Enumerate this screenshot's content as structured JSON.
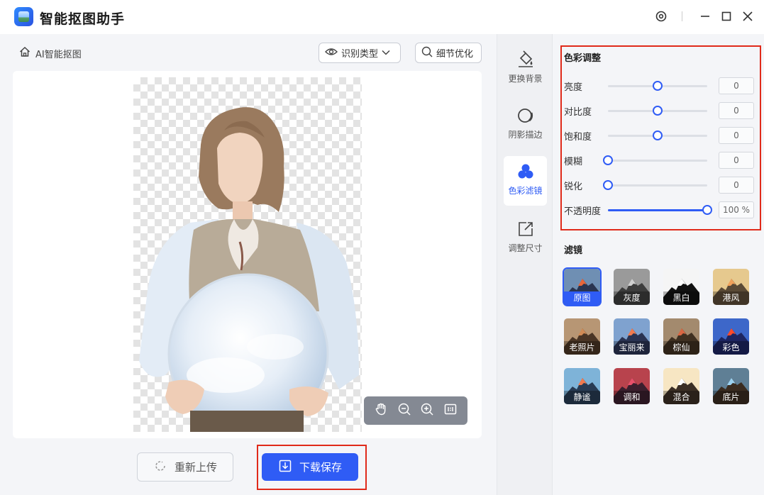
{
  "app": {
    "title": "智能抠图助手"
  },
  "left": {
    "breadcrumb": "AI智能抠图",
    "recognize_type": "识别类型",
    "detail_optimize": "细节优化",
    "reupload": "重新上传",
    "download": "下载保存"
  },
  "tools": [
    {
      "label": "更换背景",
      "icon": "paint-bucket-icon"
    },
    {
      "label": "阴影描边",
      "icon": "shadow-outline-icon"
    },
    {
      "label": "色彩滤镜",
      "icon": "color-filter-icon",
      "active": true
    },
    {
      "label": "调整尺寸",
      "icon": "resize-icon"
    }
  ],
  "color_adjust": {
    "title": "色彩调整",
    "rows": [
      {
        "label": "亮度",
        "value": "0",
        "level": 0.5
      },
      {
        "label": "对比度",
        "value": "0",
        "level": 0.5
      },
      {
        "label": "饱和度",
        "value": "0",
        "level": 0.5
      },
      {
        "label": "模糊",
        "value": "0",
        "level": 0.0
      },
      {
        "label": "锐化",
        "value": "0",
        "level": 0.0
      },
      {
        "label": "不透明度",
        "value": "100",
        "unit": "%",
        "level": 1.0
      }
    ]
  },
  "filters": {
    "title": "滤镜",
    "items": [
      {
        "label": "原图",
        "selected": true,
        "sky": "#6f8fb3",
        "peak": "#e8663a",
        "base": "#2a3550"
      },
      {
        "label": "灰度",
        "sky": "#9a9a9a",
        "peak": "#cfcfcf",
        "base": "#3d3d3d"
      },
      {
        "label": "黑白",
        "sky": "#f5f5f5",
        "peak": "#ffffff",
        "base": "#111111"
      },
      {
        "label": "港风",
        "sky": "#e6c98e",
        "peak": "#f0a15a",
        "base": "#5a4a36"
      },
      {
        "label": "老照片",
        "sky": "#b79674",
        "peak": "#d08a55",
        "base": "#4a3525"
      },
      {
        "label": "宝丽来",
        "sky": "#7fa2cf",
        "peak": "#f07a4f",
        "base": "#2a3352"
      },
      {
        "label": "棕仙",
        "sky": "#a38a6e",
        "peak": "#d86642",
        "base": "#3f3021"
      },
      {
        "label": "彩色",
        "sky": "#3d67c9",
        "peak": "#ff4a2a",
        "base": "#1d2560"
      },
      {
        "label": "静谧",
        "sky": "#7eb3d8",
        "peak": "#f07a4f",
        "base": "#283b53"
      },
      {
        "label": "调和",
        "sky": "#b8434d",
        "peak": "#e7506a",
        "base": "#3b1f2e"
      },
      {
        "label": "混合",
        "sky": "#f7e6c3",
        "peak": "#ffffff",
        "base": "#3b2f25"
      },
      {
        "label": "底片",
        "sky": "#5f7f95",
        "peak": "#9cd2f0",
        "base": "#3a2c20"
      }
    ]
  }
}
